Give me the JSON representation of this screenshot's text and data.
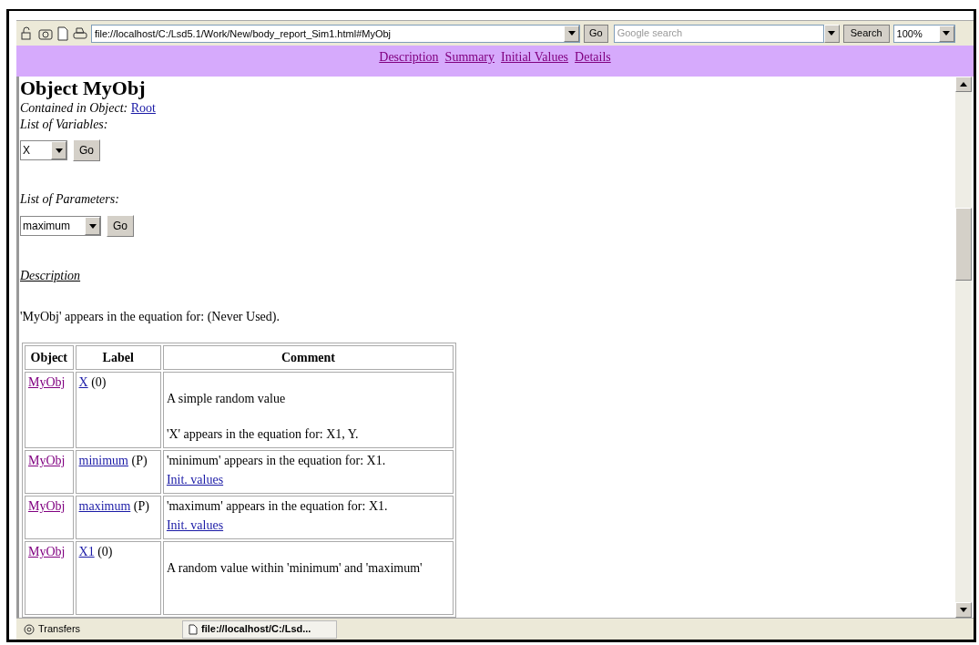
{
  "toolbar": {
    "address": "file://localhost/C:/Lsd5.1/Work/New/body_report_Sim1.html#MyObj",
    "go": "Go",
    "search_placeholder": "Google search",
    "search_button": "Search",
    "zoom": "100%"
  },
  "nav_links": [
    "Description",
    "Summary",
    "Initial Values",
    "Details"
  ],
  "page": {
    "title": "Object MyObj",
    "contained_label": "Contained in Object:",
    "contained_link": "Root",
    "variables_label": "List of Variables:",
    "variable_select": "X",
    "variable_go": "Go",
    "parameters_label": "List of Parameters:",
    "parameter_select": "maximum",
    "parameter_go": "Go",
    "description_heading": "Description",
    "usage": "'MyObj' appears in the equation for: (Never Used)."
  },
  "table": {
    "columns": [
      "Object",
      "Label",
      "Comment"
    ],
    "rows": [
      {
        "object": "MyObj",
        "label": "X",
        "suffix": "(0)",
        "comment": [
          {
            "kind": "paragraph",
            "text": "A simple random value"
          },
          {
            "kind": "paragraph",
            "text": "'X' appears in the equation for: X1, Y."
          }
        ]
      },
      {
        "object": "MyObj",
        "label": "minimum",
        "suffix": "(P)",
        "comment": [
          {
            "kind": "line",
            "text": "'minimum' appears in the equation for: X1."
          },
          {
            "kind": "link",
            "text": "Init. values"
          }
        ]
      },
      {
        "object": "MyObj",
        "label": "maximum",
        "suffix": "(P)",
        "comment": [
          {
            "kind": "line",
            "text": "'maximum' appears in the equation for: X1."
          },
          {
            "kind": "link",
            "text": "Init. values"
          }
        ]
      },
      {
        "object": "MyObj",
        "label": "X1",
        "suffix": "(0)",
        "comment": [
          {
            "kind": "paragraph",
            "text": "A random value within 'minimum' and 'maximum'"
          }
        ]
      }
    ]
  },
  "status_bar": {
    "transfers": "Transfers",
    "tab": "file://localhost/C:/Lsd..."
  }
}
